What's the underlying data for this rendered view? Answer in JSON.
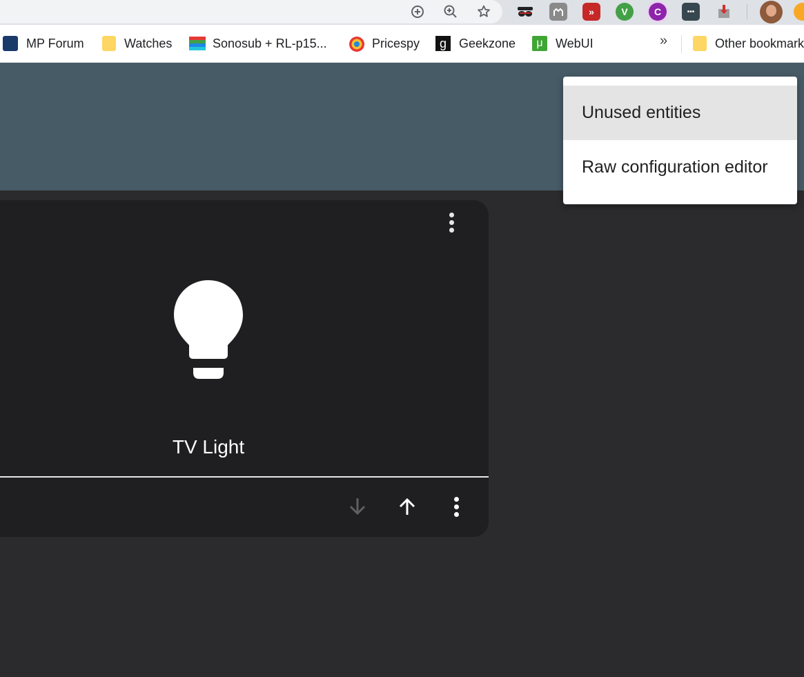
{
  "browser": {
    "omnibox_icons": [
      "add-circle-icon",
      "zoom-in-icon",
      "star-icon"
    ],
    "extensions": [
      {
        "name": "incognito-mask-icon",
        "color": "#202124"
      },
      {
        "name": "camelcamelcamel-icon",
        "color": "#8a8a8a"
      },
      {
        "name": "video-speed-icon",
        "color": "#c62828",
        "glyph": "»"
      },
      {
        "name": "shield-v-icon",
        "color": "#43a047",
        "glyph": "V"
      },
      {
        "name": "c-ring-icon",
        "color": "#8e24aa",
        "glyph": "C"
      },
      {
        "name": "password-dots-icon",
        "color": "#37474f",
        "glyph": "•••"
      },
      {
        "name": "package-download-icon",
        "color": "#9e9e9e"
      }
    ],
    "avatar_color": "#8d5a3b"
  },
  "bookmarks": [
    {
      "label": "MP Forum",
      "icon": "mp-forum-icon"
    },
    {
      "label": "Watches",
      "icon": "folder-icon"
    },
    {
      "label": "Sonosub + RL-p15...",
      "icon": "striped-flag-icon"
    },
    {
      "label": "Pricespy",
      "icon": "pricespy-icon"
    },
    {
      "label": "Geekzone",
      "icon": "geekzone-g-icon",
      "glyph": "g"
    },
    {
      "label": "WebUI",
      "icon": "webui-icon",
      "glyph": "μ"
    }
  ],
  "bookmarks_overflow": "»",
  "other_bookmarks": "Other bookmarks",
  "card": {
    "name": "TV Light",
    "icon": "lightbulb-icon"
  },
  "menu": {
    "items": [
      "Unused entities",
      "Raw configuration editor"
    ]
  },
  "colors": {
    "header": "#475b66",
    "background": "#2b2b2d",
    "card": "#1f1f21"
  }
}
